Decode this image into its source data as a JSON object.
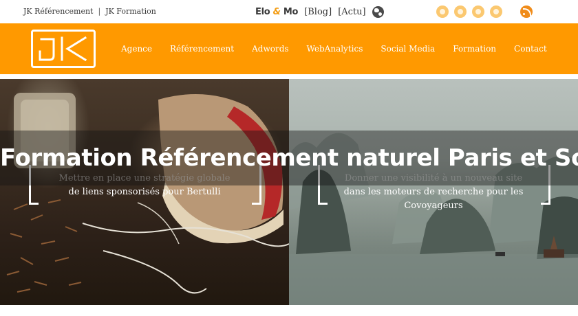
{
  "topbar": {
    "links": [
      "JK Référencement",
      "JK Formation"
    ],
    "separator": "|",
    "brand_part1": "Elo",
    "brand_amp": "&",
    "brand_part2": "Mo",
    "blog_label": "[Blog]",
    "actu_label": "[Actu]",
    "socials": [
      "social-icon",
      "social-icon",
      "social-icon",
      "social-icon"
    ],
    "rss_icon": "rss-icon",
    "globe_icon": "globe-icon"
  },
  "nav": {
    "logo_text": "JK",
    "items": [
      "Agence",
      "Référencement",
      "Adwords",
      "WebAnalytics",
      "Social Media",
      "Formation",
      "Contact"
    ]
  },
  "hero": {
    "title": "Formation Référencement naturel Paris et Sophia",
    "slides": [
      {
        "line1": "Mettre en place une stratégie globale",
        "line2": "de liens sponsorisés pour Bertulli"
      },
      {
        "line1": "Donner une visibilité à un nouveau site",
        "line2": "dans les moteurs de recherche pour les",
        "line3": "Covoyageurs"
      }
    ]
  },
  "colors": {
    "brand_orange": "#ff9900",
    "social_icon": "#fbc870",
    "rss_orange": "#f08c1a"
  }
}
